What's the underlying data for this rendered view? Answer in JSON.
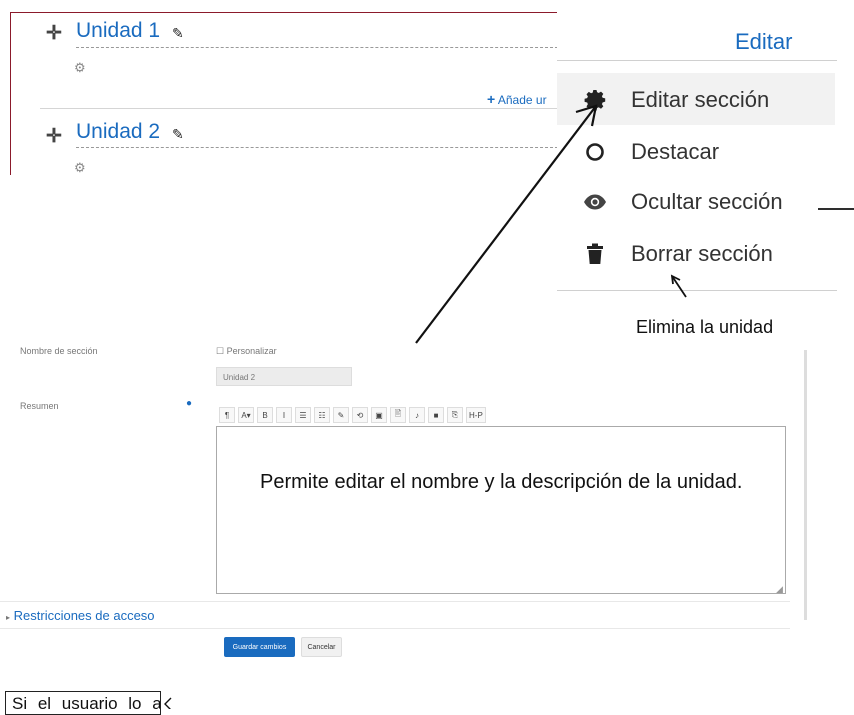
{
  "course": {
    "sections": [
      {
        "move_icon": "move-arrows-icon",
        "title": "Unidad 1",
        "edit_icon": "pencil-icon",
        "settings_icon": "gear-icon"
      },
      {
        "move_icon": "move-arrows-icon",
        "title": "Unidad 2",
        "edit_icon": "pencil-icon",
        "settings_icon": "gear-icon"
      }
    ],
    "add_section_label": "Añade ur"
  },
  "edit_menu": {
    "trigger_label": "Editar",
    "items": [
      {
        "label": "Editar sección",
        "icon": "gear-icon",
        "highlighted": true
      },
      {
        "label": "Destacar",
        "icon": "circle-outline-icon"
      },
      {
        "label": "Ocultar sección",
        "icon": "eye-icon"
      },
      {
        "label": "Borrar sección",
        "icon": "trash-icon"
      }
    ]
  },
  "annotations": {
    "delete_note": "Elimina la unidad",
    "edit_note": "Permite editar el nombre y la descripción de la unidad.",
    "hide_note": "Si el usuario lo activa, la"
  },
  "form": {
    "section_name_label": "Nombre de sección",
    "customize_label": "Personalizar",
    "section_name_value": "Unidad 2",
    "summary_label": "Resumen",
    "toolbar": [
      "¶",
      "A▾",
      "B",
      "I",
      "☰",
      "☷",
      "✎",
      "⟲",
      "▣",
      "🖹",
      "♪",
      "■",
      "⎘",
      "H-P"
    ],
    "restrictions_label": "Restricciones de acceso",
    "save_label": "Guardar cambios",
    "cancel_label": "Cancelar"
  },
  "colors": {
    "link": "#1a6bbf",
    "frame": "#8b1a2b",
    "button": "#1a6bbf"
  }
}
